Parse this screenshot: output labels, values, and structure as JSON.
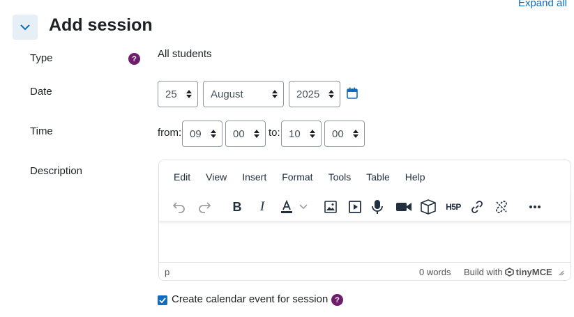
{
  "header": {
    "expand_all": "Expand all",
    "section_title": "Add session"
  },
  "form": {
    "type": {
      "label": "Type",
      "value": "All students"
    },
    "date": {
      "label": "Date",
      "day": "25",
      "month": "August",
      "year": "2025"
    },
    "time": {
      "label": "Time",
      "from_label": "from:",
      "from_hour": "09",
      "from_minute": "00",
      "to_label": "to:",
      "to_hour": "10",
      "to_minute": "00"
    },
    "description": {
      "label": "Description"
    },
    "calendar_event": {
      "label": "Create calendar event for session",
      "checked": true
    }
  },
  "editor": {
    "menus": [
      "Edit",
      "View",
      "Insert",
      "Format",
      "Tools",
      "Table",
      "Help"
    ],
    "toolbar_icons": [
      "undo-icon",
      "redo-icon",
      "bold-icon",
      "italic-icon",
      "text-color-icon",
      "image-icon",
      "media-icon",
      "microphone-icon",
      "video-camera-icon",
      "content-bank-icon",
      "h5p-icon",
      "link-icon",
      "unlink-icon",
      "more-icon"
    ],
    "path": "p",
    "word_count": "0 words",
    "build_with": "Build with",
    "brand": "tinyMCE"
  },
  "colors": {
    "accent": "#0f6cbf",
    "help": "#6f1c6d",
    "toggle_bg": "#e6eef6"
  }
}
